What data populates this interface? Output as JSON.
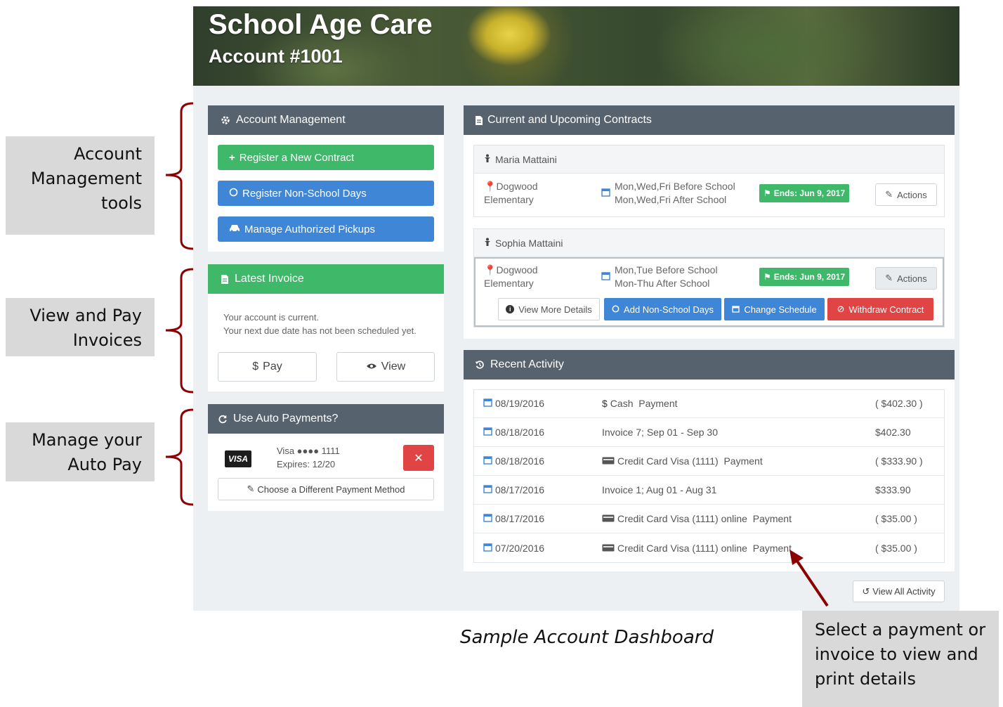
{
  "callouts": {
    "account_mgmt": "Account\nManagement\ntools",
    "invoices": "View and Pay\nInvoices",
    "autopay": "Manage your\nAuto Pay",
    "payment_select": "Select a payment or invoice to view and print details"
  },
  "caption": "Sample Account Dashboard",
  "header": {
    "title": "School Age Care",
    "account": "Account #1001"
  },
  "account_management": {
    "title": "Account Management",
    "register_contract": "Register a New Contract",
    "register_nonschool": "Register Non-School Days",
    "manage_pickups": "Manage Authorized Pickups"
  },
  "invoice": {
    "title": "Latest Invoice",
    "status_line1": "Your account is current.",
    "status_line2": "Your next due date has not been scheduled yet.",
    "pay": "Pay",
    "view": "View"
  },
  "autopay": {
    "title": "Use Auto Payments?",
    "card_brand": "VISA",
    "card_line": "Visa ●●●● 1111",
    "expires": "Expires: 12/20",
    "change_method": "Choose a Different Payment Method"
  },
  "contracts": {
    "title": "Current and Upcoming Contracts",
    "items": [
      {
        "child": "Maria Mattaini",
        "school_line1": "Dogwood",
        "school_line2": "Elementary",
        "schedule_line1": "Mon,Wed,Fri Before School",
        "schedule_line2": "Mon,Wed,Fri After School",
        "ends": "Ends: Jun 9, 2017",
        "actions": "Actions"
      },
      {
        "child": "Sophia Mattaini",
        "school_line1": "Dogwood",
        "school_line2": "Elementary",
        "schedule_line1": "Mon,Tue Before School",
        "schedule_line2": "Mon-Thu After School",
        "ends": "Ends: Jun 9, 2017",
        "actions": "Actions"
      }
    ],
    "expanded_actions": {
      "view_more": "View More Details",
      "add_nonschool": "Add Non-School Days",
      "change_schedule": "Change Schedule",
      "withdraw": "Withdraw Contract"
    }
  },
  "activity": {
    "title": "Recent Activity",
    "rows": [
      {
        "date": "08/19/2016",
        "icon": "dollar",
        "desc": "Cash  Payment",
        "amount": "( $402.30 )"
      },
      {
        "date": "08/18/2016",
        "icon": "none",
        "desc": "Invoice 7; Sep 01 - Sep 30",
        "amount": "$402.30"
      },
      {
        "date": "08/18/2016",
        "icon": "card",
        "desc": "Credit Card Visa (1111)  Payment",
        "amount": "( $333.90 )"
      },
      {
        "date": "08/17/2016",
        "icon": "none",
        "desc": "Invoice 1; Aug 01 - Aug 31",
        "amount": "$333.90"
      },
      {
        "date": "08/17/2016",
        "icon": "card",
        "desc": "Credit Card Visa (1111) online  Payment",
        "amount": "( $35.00 )"
      },
      {
        "date": "07/20/2016",
        "icon": "card",
        "desc": "Credit Card Visa (1111) online  Payment",
        "amount": "( $35.00 )"
      }
    ],
    "view_all": "View All Activity"
  },
  "colors": {
    "header_bar": "#56626d",
    "success": "#3fb86a",
    "primary": "#3f86d6",
    "danger": "#e04444",
    "annotation": "#8b0000"
  }
}
